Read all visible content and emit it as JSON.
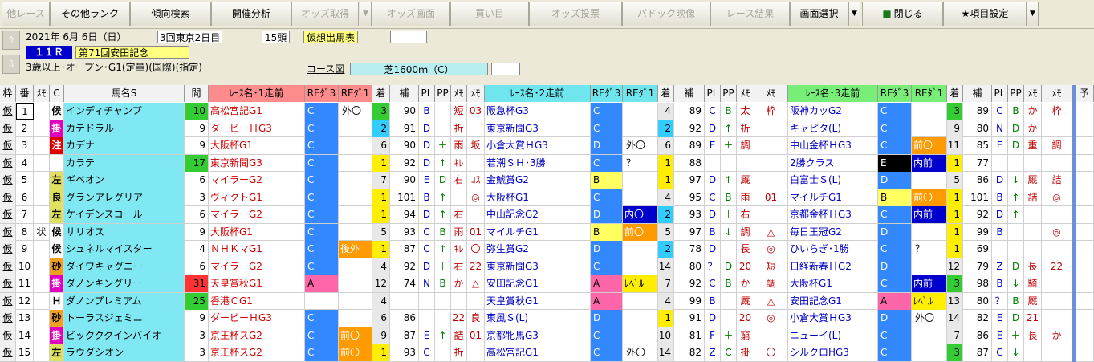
{
  "toolbar": {
    "items": [
      {
        "label": "他レース",
        "enabled": false
      },
      {
        "label": "その他ランク",
        "enabled": true
      },
      {
        "label": "傾向検索",
        "enabled": true
      },
      {
        "label": "開催分析",
        "enabled": true
      },
      {
        "label": "オッズ取得",
        "enabled": false
      },
      {
        "label": "オッズ画面",
        "enabled": false
      },
      {
        "label": "買い目",
        "enabled": false
      },
      {
        "label": "オッズ投票",
        "enabled": false
      },
      {
        "label": "パドック映像",
        "enabled": false
      },
      {
        "label": "レース結果",
        "enabled": false
      },
      {
        "label": "画面選択",
        "enabled": true
      },
      {
        "label": "閉じる",
        "enabled": true
      },
      {
        "label": "★項目設定",
        "enabled": true
      }
    ],
    "drop": "▼",
    "close_icon_glyph": "�"
  },
  "race": {
    "date": "2021年  6月  6日（日）",
    "meeting": "3回東京2日目",
    "runners": "15頭",
    "mode": "仮想出馬表",
    "race_no": "１１Ｒ",
    "race_name": "第71回安田記念",
    "conditions": "3歳以上･オープン･G1(定量)(国際)(指定)",
    "course_label": "コース図",
    "course": "芝1600ｍ（C）",
    "up_arrow": "⇧",
    "down_arrow": "⇩"
  },
  "header": {
    "waku": "枠",
    "ban": "番",
    "memo": "ﾒﾓ",
    "c": "Ｃ",
    "name": "馬名S",
    "interval": "間",
    "race1": "ﾚｰｽ名･1走前",
    "race2": "ﾚｰｽ名･2走前",
    "race3": "ﾚｰｽ名･3走前",
    "red3": "REﾀﾞ3",
    "red1": "REﾀﾞ1",
    "chaku": "着",
    "ho": "補",
    "pl": "PL",
    "pp": "PP",
    "m1": "ﾒﾓ",
    "m2": "ﾒﾓ",
    "yo": "予"
  },
  "rows": [
    {
      "waku": "仮",
      "ban": "1",
      "mark": "",
      "c": "候",
      "name": "インディチャンプ",
      "iv": "10",
      "r1": [
        "高松宮記G1",
        "C",
        "外〇",
        "3",
        "90",
        "B",
        "",
        "短",
        "03"
      ],
      "r2": [
        "阪急杯G3",
        "C",
        "",
        "4",
        "89",
        "C",
        "B",
        "太",
        "枠"
      ],
      "r3": [
        "阪神カッG2",
        "C",
        "",
        "3",
        "89",
        "C",
        "B",
        "か",
        "枠"
      ]
    },
    {
      "waku": "仮",
      "ban": "2",
      "mark": "",
      "c": "掛",
      "name": "カテドラル",
      "iv": "9",
      "r1": [
        "ダービーＨG3",
        "C",
        "",
        "2",
        "91",
        "D",
        "",
        "折",
        ""
      ],
      "r2": [
        "東京新聞G3",
        "C",
        "",
        "2",
        "92",
        "D",
        "↑",
        "折",
        ""
      ],
      "r3": [
        "キャピタ(L)",
        "C",
        "",
        "9",
        "80",
        "N",
        "D",
        "か",
        ""
      ]
    },
    {
      "waku": "仮",
      "ban": "3",
      "mark": "",
      "c": "注",
      "name": "カデナ",
      "iv": "9",
      "r1": [
        "大阪杯G1",
        "C",
        "",
        "6",
        "90",
        "D",
        "＋",
        "雨",
        "坂"
      ],
      "r2": [
        "小倉大賞ＨG3",
        "D",
        "外〇",
        "6",
        "89",
        "E",
        "＋",
        "調",
        ""
      ],
      "r3": [
        "中山金杯ＨG3",
        "C",
        "前〇",
        "11",
        "85",
        "E",
        "D",
        "重",
        "調"
      ]
    },
    {
      "waku": "仮",
      "ban": "4",
      "mark": "",
      "c": "",
      "name": "カラテ",
      "iv": "17",
      "r1": [
        "東京新聞G3",
        "C",
        "",
        "1",
        "92",
        "D",
        "↑",
        "ｷﾚ",
        ""
      ],
      "r2": [
        "若潮ＳＨ･3勝",
        "C",
        "？",
        "1",
        "88",
        "",
        "",
        "",
        ""
      ],
      "r3": [
        "2勝クラス",
        "E",
        "内前",
        "1",
        "77",
        "",
        "",
        "",
        ""
      ]
    },
    {
      "waku": "仮",
      "ban": "5",
      "mark": "",
      "c": "左",
      "name": "ギベオン",
      "iv": "6",
      "r1": [
        "マイラーG2",
        "C",
        "",
        "7",
        "90",
        "E",
        "D",
        "右",
        "ｺｽ"
      ],
      "r2": [
        "金鯱賞G2",
        "B",
        "",
        "1",
        "97",
        "D",
        "↑",
        "厩",
        ""
      ],
      "r3": [
        "白富士Ｓ(L)",
        "D",
        "",
        "5",
        "86",
        "D",
        "↓",
        "厩",
        "詰"
      ]
    },
    {
      "waku": "仮",
      "ban": "6",
      "mark": "",
      "c": "良",
      "name": "グランアレグリア",
      "iv": "3",
      "r1": [
        "ヴィクトG1",
        "C",
        "",
        "1",
        "101",
        "B",
        "↑",
        "",
        "◎"
      ],
      "r2": [
        "大阪杯G1",
        "C",
        "",
        "4",
        "95",
        "C",
        "B",
        "雨",
        "01"
      ],
      "r3": [
        "マイルチG1",
        "B",
        "前〇",
        "1",
        "101",
        "B",
        "↑",
        "詰",
        "◎"
      ]
    },
    {
      "waku": "仮",
      "ban": "7",
      "mark": "",
      "c": "左",
      "name": "ケイデンスコール",
      "iv": "6",
      "r1": [
        "マイラーG2",
        "C",
        "",
        "1",
        "94",
        "D",
        "↑",
        "右",
        ""
      ],
      "r2": [
        "中山記念G2",
        "D",
        "内〇",
        "2",
        "93",
        "D",
        "＋",
        "右",
        ""
      ],
      "r3": [
        "京都金杯ＨG3",
        "C",
        "内前",
        "1",
        "92",
        "D",
        "↑",
        "",
        ""
      ]
    },
    {
      "waku": "仮",
      "ban": "8",
      "mark": "状",
      "c": "候",
      "name": "サリオス",
      "iv": "9",
      "r1": [
        "大阪杯G1",
        "C",
        "",
        "5",
        "93",
        "C",
        "B",
        "雨",
        "01"
      ],
      "r2": [
        "マイルチG1",
        "B",
        "前〇",
        "5",
        "97",
        "B",
        "↓",
        "調",
        "△"
      ],
      "r3": [
        "毎日王冠G2",
        "D",
        "",
        "1",
        "99",
        "B",
        "",
        "",
        "◎"
      ]
    },
    {
      "waku": "仮",
      "ban": "9",
      "mark": "",
      "c": "候",
      "name": "シュネルマイスター",
      "iv": "4",
      "r1": [
        "ＮＨＫマG1",
        "C",
        "後外",
        "1",
        "87",
        "C",
        "↑",
        "ｷﾚ",
        "〇"
      ],
      "r2": [
        "弥生賞G2",
        "D",
        "",
        "2",
        "78",
        "D",
        "",
        "長",
        "◎"
      ],
      "r3": [
        "ひいらぎ･1勝",
        "C",
        "？",
        "1",
        "69",
        "",
        "",
        "",
        ""
      ]
    },
    {
      "waku": "仮",
      "ban": "10",
      "mark": "",
      "c": "砂",
      "name": "ダイワキャグニー",
      "iv": "6",
      "r1": [
        "マイラーG2",
        "C",
        "",
        "4",
        "92",
        "D",
        "＋",
        "右",
        "22"
      ],
      "r2": [
        "東京新聞G3",
        "C",
        "",
        "14",
        "80",
        "？",
        "D",
        "20",
        "短"
      ],
      "r3": [
        "日経新春ＨG2",
        "D",
        "",
        "12",
        "79",
        "Z",
        "D",
        "長",
        "22"
      ]
    },
    {
      "waku": "仮",
      "ban": "11",
      "mark": "",
      "c": "掛",
      "name": "ダノンキングリー",
      "iv": "31",
      "r1": [
        "天皇賞秋G1",
        "A",
        "",
        "12",
        "74",
        "N",
        "B",
        "か",
        "△"
      ],
      "r2": [
        "安田記念G1",
        "A",
        "ﾚﾍﾞﾙ",
        "7",
        "92",
        "C",
        "B",
        "か",
        "調"
      ],
      "r3": [
        "大阪杯G1",
        "C",
        "内前",
        "3",
        "98",
        "B",
        "↓",
        "騎",
        ""
      ]
    },
    {
      "waku": "仮",
      "ban": "12",
      "mark": "",
      "c": "Ｈ",
      "name": "ダノンプレミアム",
      "iv": "25",
      "r1": [
        "香港ＣG1",
        "",
        "",
        "4",
        "",
        "",
        "",
        "",
        ""
      ],
      "r2": [
        "天皇賞秋G1",
        "A",
        "",
        "4",
        "99",
        "B",
        "",
        "厩",
        "△"
      ],
      "r3": [
        "安田記念G1",
        "A",
        "ﾚﾍﾞﾙ",
        "13",
        "80",
        "？",
        "B",
        "厩",
        ""
      ]
    },
    {
      "waku": "仮",
      "ban": "13",
      "mark": "",
      "c": "砂",
      "name": "トーラスジェミニ",
      "iv": "9",
      "r1": [
        "ダービーＨG3",
        "C",
        "",
        "6",
        "86",
        "",
        "",
        "22",
        "良"
      ],
      "r2": [
        "東風Ｓ(L)",
        "D",
        "",
        "1",
        "91",
        "D",
        "",
        "20",
        "◎"
      ],
      "r3": [
        "小倉大賞ＨG3",
        "D",
        "外〇",
        "14",
        "82",
        "E",
        "D",
        "21",
        ""
      ]
    },
    {
      "waku": "仮",
      "ban": "14",
      "mark": "",
      "c": "掛",
      "name": "ビックククインバイオ",
      "iv": "3",
      "r1": [
        "京王杯スG2",
        "C",
        "前〇",
        "9",
        "87",
        "E",
        "↑",
        "詰",
        "01"
      ],
      "r2": [
        "京都牝馬G3",
        "C",
        "",
        "10",
        "81",
        "F",
        "＋",
        "窮",
        ""
      ],
      "r3": [
        "ニューイ(L)",
        "C",
        "",
        "7",
        "86",
        "E",
        "＋",
        "長",
        "か"
      ]
    },
    {
      "waku": "仮",
      "ban": "15",
      "mark": "",
      "c": "左",
      "name": "ラウダシオン",
      "iv": "3",
      "r1": [
        "京王杯スG2",
        "C",
        "前〇",
        "1",
        "93",
        "C",
        "",
        "折",
        ""
      ],
      "r2": [
        "高松宮記G1",
        "C",
        "外〇",
        "14",
        "82",
        "Z",
        "C",
        "掛",
        "〇"
      ],
      "r3": [
        "シルクロHG3",
        "C",
        "",
        "3",
        "87",
        "C",
        "↓",
        "",
        ""
      ]
    }
  ]
}
